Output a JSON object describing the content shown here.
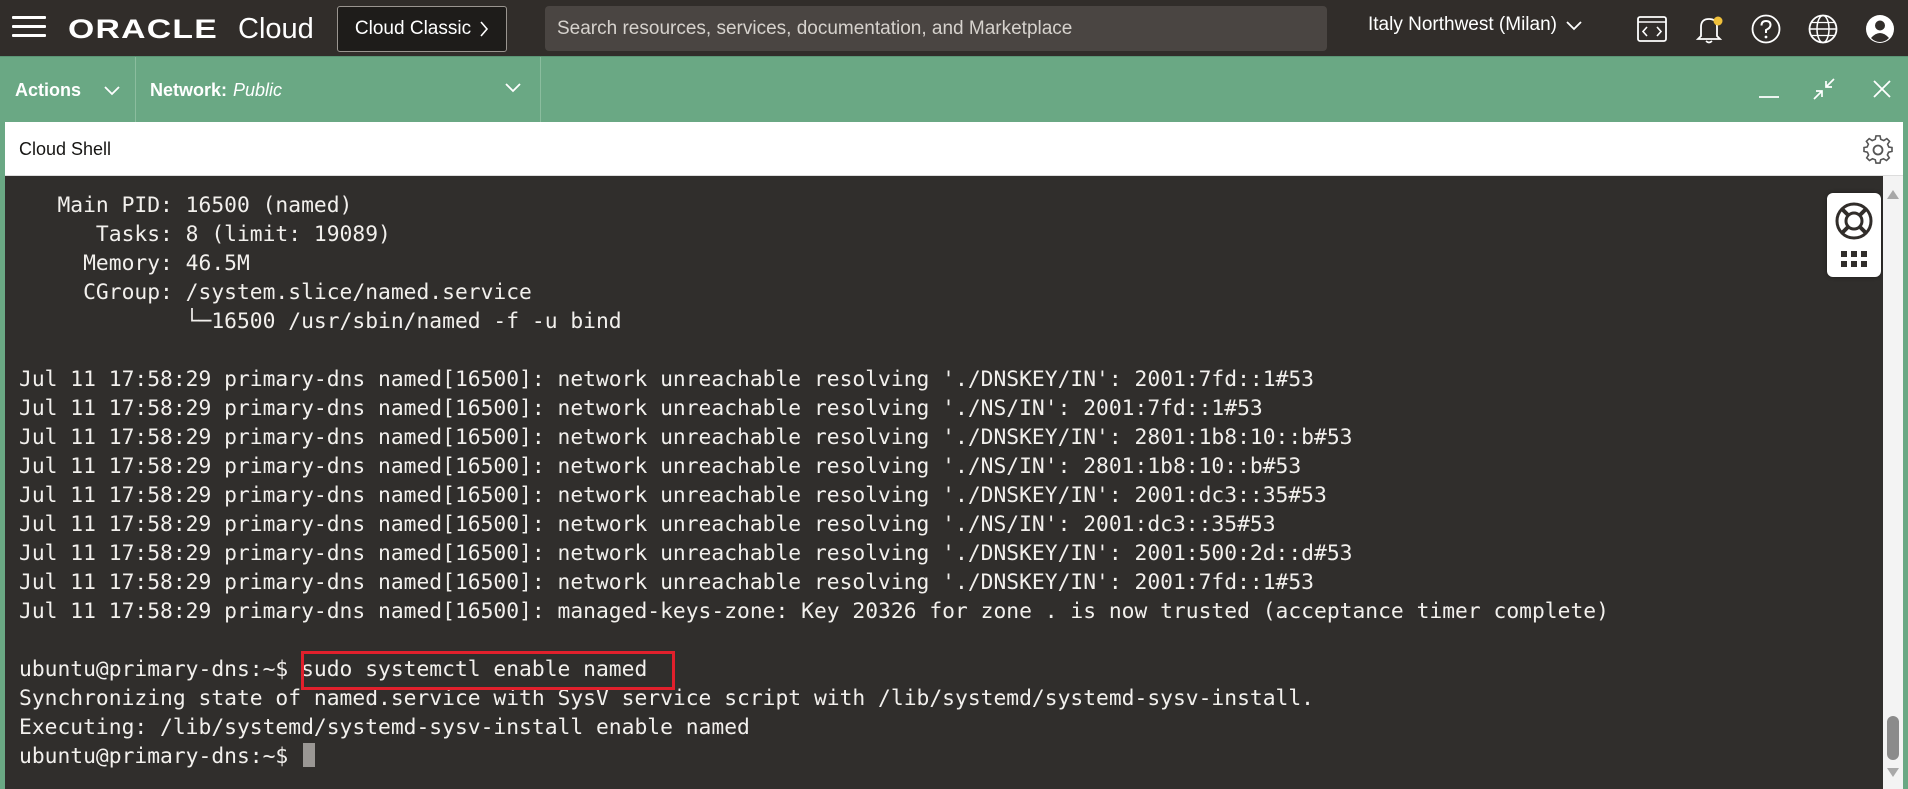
{
  "header": {
    "menu_icon": "hamburger-menu-icon",
    "logo_oracle": "ORACLE",
    "logo_cloud": "Cloud",
    "classic_button": "Cloud Classic",
    "search_placeholder": "Search resources, services, documentation, and Marketplace",
    "region": "Italy Northwest (Milan)",
    "icons": [
      "code-editor-icon",
      "notification-bell-icon",
      "help-icon",
      "language-globe-icon",
      "user-avatar-icon"
    ]
  },
  "shell_toolbar": {
    "actions_label": "Actions",
    "network_label": "Network:",
    "network_value": "Public"
  },
  "panel": {
    "title": "Cloud Shell"
  },
  "terminal": {
    "lines": [
      "   Main PID: 16500 (named)",
      "      Tasks: 8 (limit: 19089)",
      "     Memory: 46.5M",
      "     CGroup: /system.slice/named.service",
      "             └─16500 /usr/sbin/named -f -u bind",
      "",
      "Jul 11 17:58:29 primary-dns named[16500]: network unreachable resolving './DNSKEY/IN': 2001:7fd::1#53",
      "Jul 11 17:58:29 primary-dns named[16500]: network unreachable resolving './NS/IN': 2001:7fd::1#53",
      "Jul 11 17:58:29 primary-dns named[16500]: network unreachable resolving './DNSKEY/IN': 2801:1b8:10::b#53",
      "Jul 11 17:58:29 primary-dns named[16500]: network unreachable resolving './NS/IN': 2801:1b8:10::b#53",
      "Jul 11 17:58:29 primary-dns named[16500]: network unreachable resolving './DNSKEY/IN': 2001:dc3::35#53",
      "Jul 11 17:58:29 primary-dns named[16500]: network unreachable resolving './NS/IN': 2001:dc3::35#53",
      "Jul 11 17:58:29 primary-dns named[16500]: network unreachable resolving './DNSKEY/IN': 2001:500:2d::d#53",
      "Jul 11 17:58:29 primary-dns named[16500]: network unreachable resolving './DNSKEY/IN': 2001:7fd::1#53",
      "Jul 11 17:58:29 primary-dns named[16500]: managed-keys-zone: Key 20326 for zone . is now trusted (acceptance timer complete)",
      "",
      "ubuntu@primary-dns:~$ sudo systemctl enable named",
      "Synchronizing state of named.service with SysV service script with /lib/systemd/systemd-sysv-install.",
      "Executing: /lib/systemd/systemd-sysv-install enable named",
      "ubuntu@primary-dns:~$ "
    ],
    "highlighted_command": "sudo systemctl enable named",
    "highlight_color": "#e1202c"
  },
  "colors": {
    "header_bg": "#312d2a",
    "shell_bar": "#6aa884",
    "terminal_bg": "#302e2c"
  }
}
